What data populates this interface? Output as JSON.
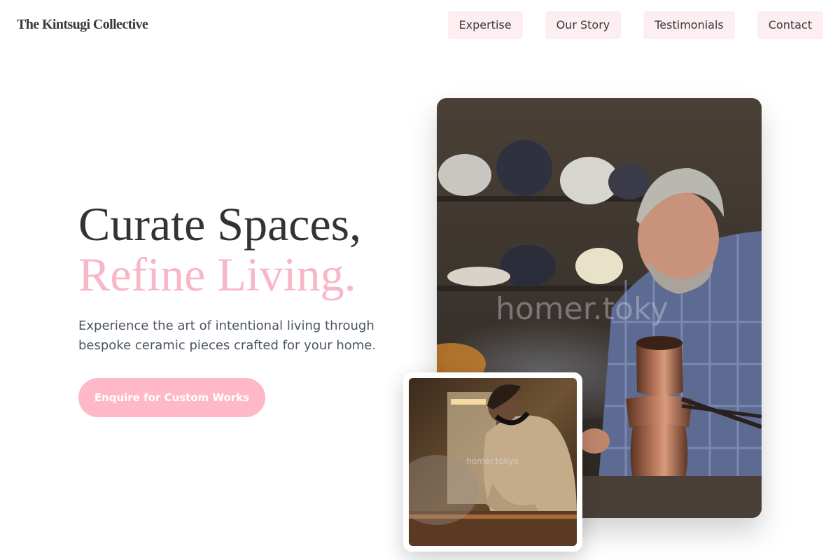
{
  "header": {
    "brand": "The Kintsugi Collective",
    "nav": [
      {
        "label": "Expertise"
      },
      {
        "label": "Our Story"
      },
      {
        "label": "Testimonials"
      },
      {
        "label": "Contact"
      }
    ]
  },
  "hero": {
    "title_line1": "Curate Spaces,",
    "title_line2": "Refine Living.",
    "subtitle": "Experience the art of intentional living through bespoke ceramic pieces crafted for your home.",
    "cta_label": "Enquire for Custom Works"
  },
  "images": {
    "main_watermark": "homer.toky",
    "small_watermark": "homer.tokyo"
  },
  "colors": {
    "accent_pink": "#f8b7c6",
    "nav_bg": "#fdeef1",
    "cta_bg": "#ffb8c8"
  }
}
